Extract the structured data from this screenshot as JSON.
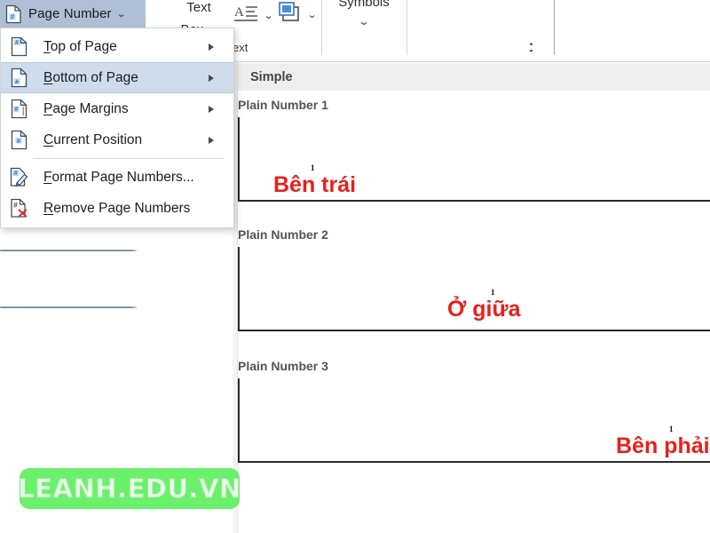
{
  "ribbon": {
    "page_number_button": {
      "label": "Page Number",
      "chevron": "chevron-down",
      "icon": "page-number-icon"
    },
    "text_box_button": {
      "line1": "Text",
      "line2": "Box",
      "chevron": "chevron-down"
    },
    "wordart_button": {
      "label": "",
      "icon": "wordart-icon",
      "chevron": "chevron-down"
    },
    "dropcap_button": {
      "label": "",
      "icon": "drop-cap-icon",
      "chevron": "chevron-down"
    },
    "symbols_group": {
      "label": "Symbols",
      "chevron": "chevron-down"
    },
    "text_group_label": "ext",
    "collapse_ribbon": "collapse-ribbon-chevron"
  },
  "menu": {
    "items": [
      {
        "label": "Top of Page",
        "accel": "T",
        "icon": "page-top-number-icon",
        "has_submenu": true,
        "selected": false
      },
      {
        "label": "Bottom of Page",
        "accel": "B",
        "icon": "page-bottom-number-icon",
        "has_submenu": true,
        "selected": true
      },
      {
        "label": "Page Margins",
        "accel": "P",
        "icon": "page-margins-number-icon",
        "has_submenu": true,
        "selected": false
      },
      {
        "label": "Current Position",
        "accel": "C",
        "icon": "page-current-position-icon",
        "has_submenu": true,
        "selected": false
      },
      {
        "separator": true
      },
      {
        "label": "Format Page Numbers...",
        "accel": "F",
        "icon": "format-page-numbers-icon",
        "has_submenu": false,
        "selected": false
      },
      {
        "label": "Remove Page Numbers",
        "accel": "R",
        "icon": "remove-page-numbers-icon",
        "has_submenu": false,
        "selected": false
      }
    ]
  },
  "gallery": {
    "header": "Simple",
    "items": [
      {
        "title": "Plain Number 1",
        "page_number": "1",
        "caption": "Bên trái",
        "align": "left"
      },
      {
        "title": "Plain Number 2",
        "page_number": "1",
        "caption": "Ở giữa",
        "align": "center"
      },
      {
        "title": "Plain Number 3",
        "page_number": "1",
        "caption": "Bên phải",
        "align": "right"
      }
    ]
  },
  "watermark": {
    "text": "LEANH.EDU.VN",
    "background_color": "#6bf06b",
    "text_color": "#e9ffe9"
  },
  "colors": {
    "accent_selected": "#cfdcec",
    "button_highlight": "#afc0d6",
    "caption_red": "#e8201a",
    "gallery_header_bg": "#eeeeee"
  }
}
